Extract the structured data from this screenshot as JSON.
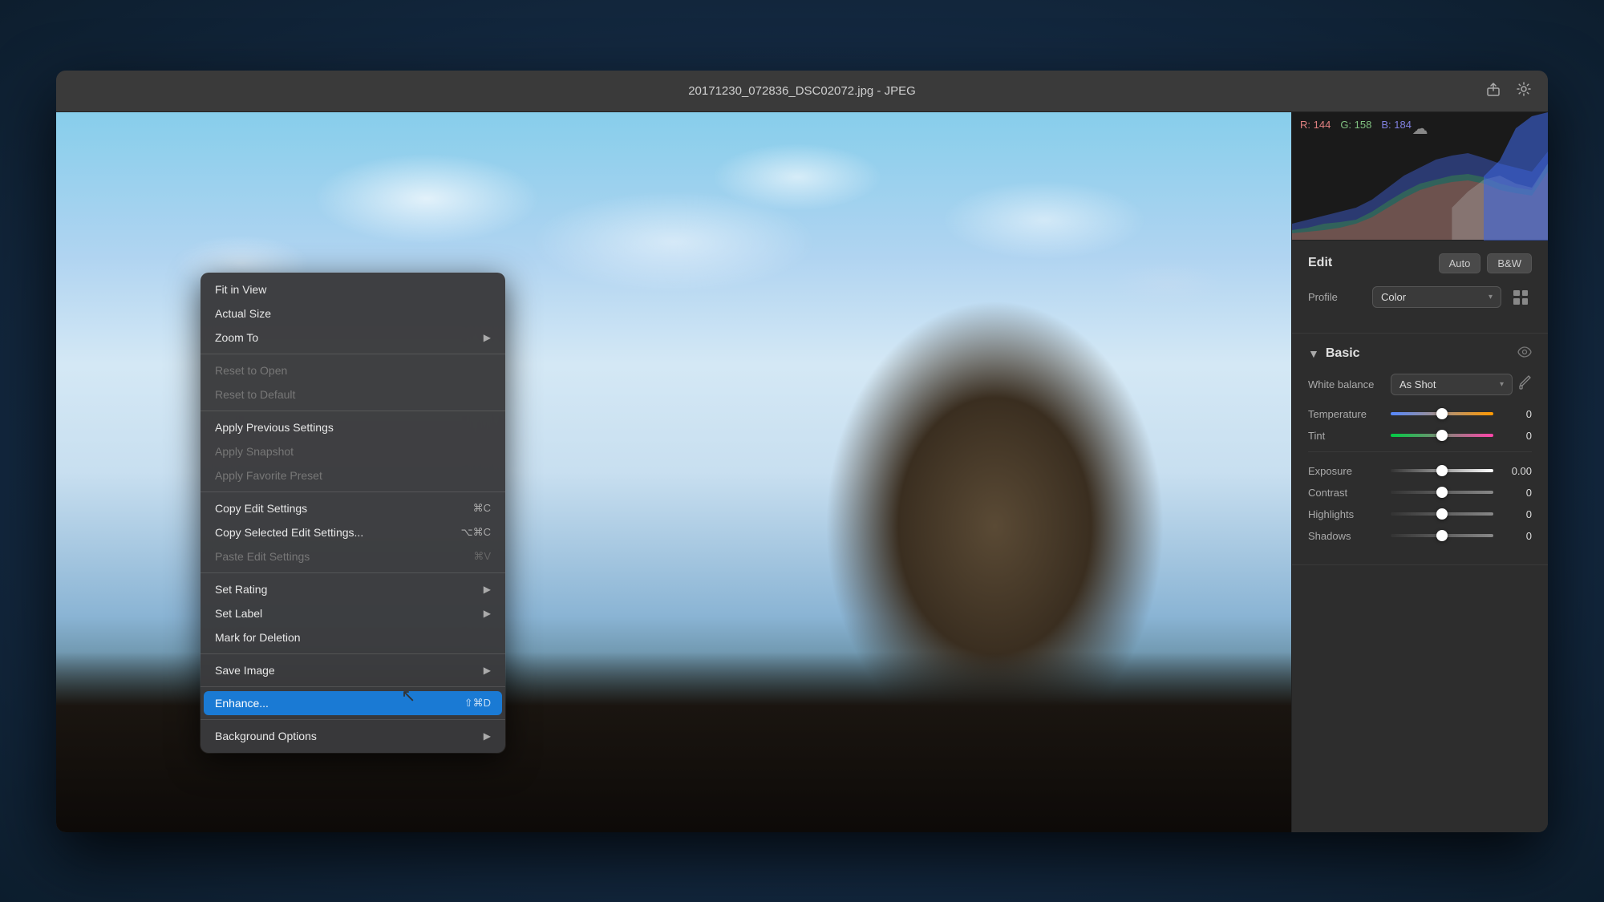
{
  "window": {
    "title": "20171230_072836_DSC02072.jpg  -  JPEG"
  },
  "histogram": {
    "r_label": "R: 144",
    "g_label": "G: 158",
    "b_label": "B: 184"
  },
  "edit_panel": {
    "section_title": "Edit",
    "auto_button": "Auto",
    "bw_button": "B&W",
    "profile_label": "Profile",
    "profile_value": "Color",
    "basic_section": "Basic",
    "white_balance_label": "White balance",
    "white_balance_value": "As Shot",
    "temperature_label": "Temperature",
    "temperature_value": "0",
    "tint_label": "Tint",
    "tint_value": "0",
    "exposure_label": "Exposure",
    "exposure_value": "0.00",
    "contrast_label": "Contrast",
    "contrast_value": "0",
    "highlights_label": "Highlights",
    "highlights_value": "0",
    "shadows_label": "Shadows",
    "shadows_value": "0"
  },
  "context_menu": {
    "items": [
      {
        "id": "fit-in-view",
        "label": "Fit in View",
        "shortcut": "",
        "has_arrow": false,
        "disabled": false,
        "separator_after": false
      },
      {
        "id": "actual-size",
        "label": "Actual Size",
        "shortcut": "",
        "has_arrow": false,
        "disabled": false,
        "separator_after": false
      },
      {
        "id": "zoom-to",
        "label": "Zoom To",
        "shortcut": "",
        "has_arrow": true,
        "disabled": false,
        "separator_after": true
      },
      {
        "id": "reset-to-open",
        "label": "Reset to Open",
        "shortcut": "",
        "has_arrow": false,
        "disabled": true,
        "separator_after": false
      },
      {
        "id": "reset-to-default",
        "label": "Reset to Default",
        "shortcut": "",
        "has_arrow": false,
        "disabled": true,
        "separator_after": true
      },
      {
        "id": "apply-previous-settings",
        "label": "Apply Previous Settings",
        "shortcut": "",
        "has_arrow": false,
        "disabled": false,
        "separator_after": false
      },
      {
        "id": "apply-snapshot",
        "label": "Apply Snapshot",
        "shortcut": "",
        "has_arrow": false,
        "disabled": true,
        "separator_after": false
      },
      {
        "id": "apply-favorite-preset",
        "label": "Apply Favorite Preset",
        "shortcut": "",
        "has_arrow": false,
        "disabled": true,
        "separator_after": true
      },
      {
        "id": "copy-edit-settings",
        "label": "Copy Edit Settings",
        "shortcut": "⌘C",
        "has_arrow": false,
        "disabled": false,
        "separator_after": false
      },
      {
        "id": "copy-selected-edit-settings",
        "label": "Copy Selected Edit Settings...",
        "shortcut": "⌥⌘C",
        "has_arrow": false,
        "disabled": false,
        "separator_after": false
      },
      {
        "id": "paste-edit-settings",
        "label": "Paste Edit Settings",
        "shortcut": "⌘V",
        "has_arrow": false,
        "disabled": true,
        "separator_after": true
      },
      {
        "id": "set-rating",
        "label": "Set Rating",
        "shortcut": "",
        "has_arrow": true,
        "disabled": false,
        "separator_after": false
      },
      {
        "id": "set-label",
        "label": "Set Label",
        "shortcut": "",
        "has_arrow": true,
        "disabled": false,
        "separator_after": false
      },
      {
        "id": "mark-for-deletion",
        "label": "Mark for Deletion",
        "shortcut": "",
        "has_arrow": false,
        "disabled": false,
        "separator_after": true
      },
      {
        "id": "save-image",
        "label": "Save Image",
        "shortcut": "",
        "has_arrow": true,
        "disabled": false,
        "separator_after": true
      },
      {
        "id": "enhance",
        "label": "Enhance...",
        "shortcut": "⇧⌘D",
        "has_arrow": false,
        "disabled": false,
        "highlighted": true,
        "separator_after": true
      },
      {
        "id": "background-options",
        "label": "Background Options",
        "shortcut": "",
        "has_arrow": true,
        "disabled": false,
        "separator_after": false
      }
    ]
  }
}
